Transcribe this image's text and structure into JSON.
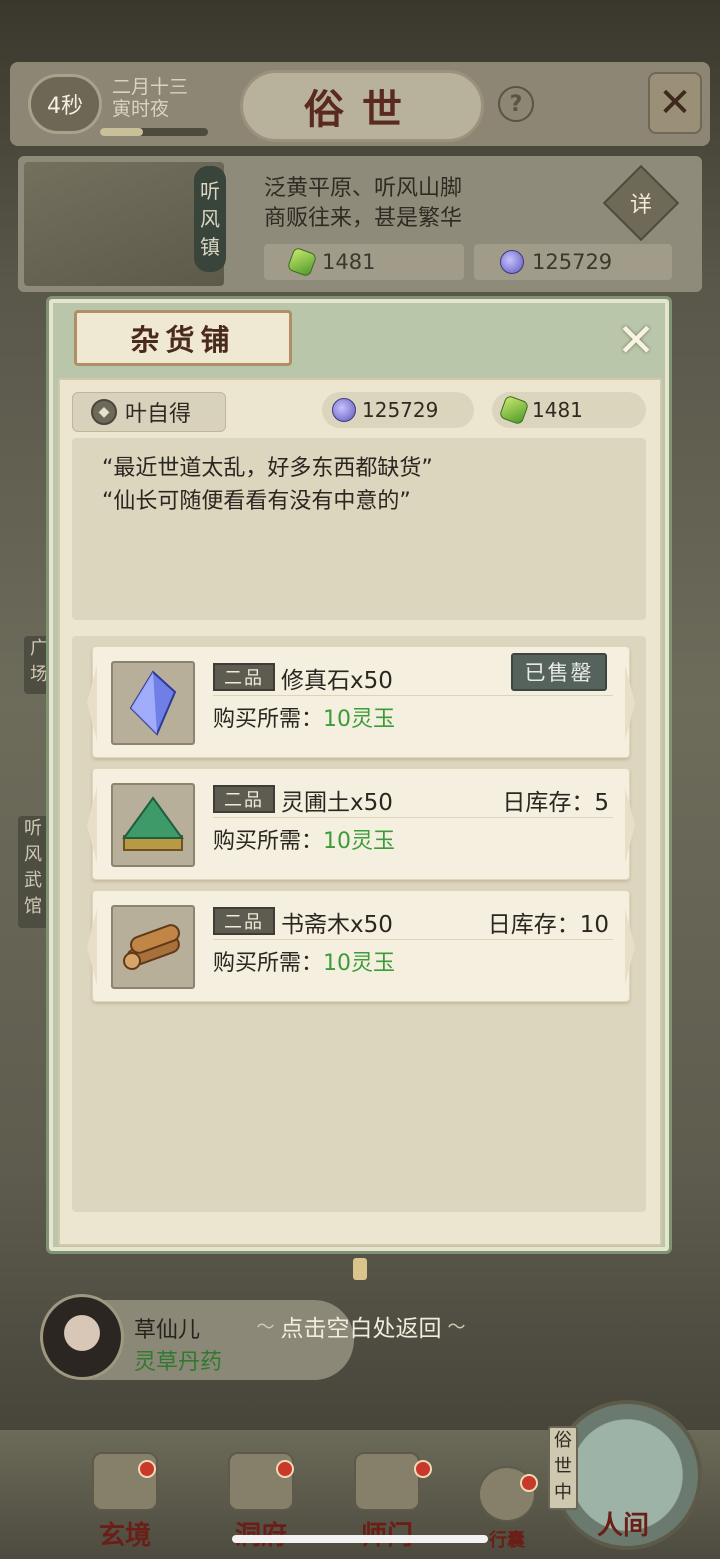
{
  "status": {
    "timer": "4秒",
    "date_line1": "二月十三",
    "date_line2": "寅时夜",
    "scene_title": "俗世",
    "help_label": "?"
  },
  "location": {
    "name_chars": [
      "听",
      "风",
      "镇"
    ],
    "desc_line1": "泛黄平原、听风山脚",
    "desc_line2": "商贩往来，甚是繁华",
    "detail_label": "详",
    "jade": "1481",
    "coins": "125729"
  },
  "side_labels": {
    "left_1": "广场",
    "left_2": "听风武馆"
  },
  "shop": {
    "title": "杂货铺",
    "merchant_name": "叶自得",
    "coins": "125729",
    "jade": "1481",
    "dialogue_line1": "“最近世道太乱，好多东西都缺货”",
    "dialogue_line2": "“仙长可随便看看有没有中意的”",
    "items": [
      {
        "grade": "二品",
        "name": "修真石x50",
        "cost_label": "购买所需：",
        "cost": "10灵玉",
        "status": "已售罄",
        "icon": "crystal-icon"
      },
      {
        "grade": "二品",
        "name": "灵圃土x50",
        "cost_label": "购买所需：",
        "cost": "10灵玉",
        "stock": "日库存：5",
        "icon": "soil-icon"
      },
      {
        "grade": "二品",
        "name": "书斋木x50",
        "cost_label": "购买所需：",
        "cost": "10灵玉",
        "stock": "日库存：10",
        "icon": "wood-icon"
      }
    ]
  },
  "npc": {
    "name": "草仙儿",
    "role": "灵草丹药"
  },
  "tap_hint": "点击空白处返回",
  "nav": {
    "items": [
      "玄境",
      "洞府",
      "师门",
      "行囊",
      "人间"
    ],
    "world_vertical": "俗世中"
  },
  "colors": {
    "price_green": "#3c9c3a",
    "title_red": "#5a2a1e",
    "dialog_frame": "#b9c6aa",
    "soldout_bg": "#56635d"
  }
}
